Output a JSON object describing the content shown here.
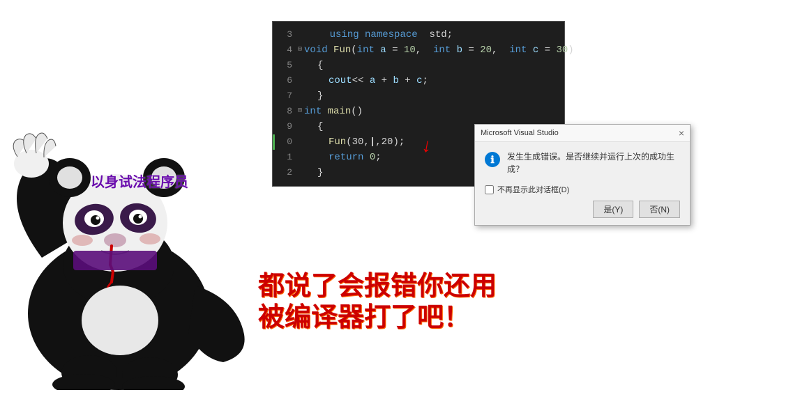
{
  "editor": {
    "lines": [
      {
        "num": "3",
        "hasCollapse": false,
        "hasIndicator": false,
        "indent": 0,
        "html": "    <span class='keyword'>using</span> <span class='keyword'>namespace</span> <span style='color:#d4d4d4'>std;</span>"
      },
      {
        "num": "4",
        "hasCollapse": true,
        "hasIndicator": false,
        "indent": 0,
        "html": "<span class='keyword'>void</span> <span class='function-name'>Fun</span>(<span class='keyword'>int</span> <span class='param-var'>a</span> <span class='operator'>=</span> <span class='number'>10</span>,  <span class='keyword'>int</span> <span class='param-var'>b</span> <span class='operator'>=</span> <span class='number'>20</span>,  <span class='keyword'>int</span> <span class='param-var'>c</span> <span class='operator'>=</span> <span class='number'>30</span>)"
      },
      {
        "num": "5",
        "hasCollapse": false,
        "hasIndicator": false,
        "indent": 1,
        "html": "{"
      },
      {
        "num": "6",
        "hasCollapse": false,
        "hasIndicator": false,
        "indent": 2,
        "html": "<span style='color:#9cdcfe'>cout</span><span class='operator'>&lt;&lt;</span> <span class='param-var'>a</span> <span class='operator'>+</span> <span class='param-var'>b</span> <span class='operator'>+</span> <span class='param-var'>c</span>;"
      },
      {
        "num": "7",
        "hasCollapse": false,
        "hasIndicator": false,
        "indent": 1,
        "html": "}"
      },
      {
        "num": "8",
        "hasCollapse": true,
        "hasIndicator": false,
        "indent": 0,
        "html": "<span class='keyword'>int</span> <span class='function-name'>main</span>()"
      },
      {
        "num": "9",
        "hasCollapse": false,
        "hasIndicator": false,
        "indent": 1,
        "html": "{"
      },
      {
        "num": "0",
        "hasCollapse": false,
        "hasIndicator": true,
        "indent": 2,
        "html": "<span class='function-name'>Fun</span>(30,<span style='color:red'>|</span>,20);"
      },
      {
        "num": "1",
        "hasCollapse": false,
        "hasIndicator": false,
        "indent": 2,
        "html": "<span class='keyword'>return</span> <span class='number'>0</span>;"
      },
      {
        "num": "2",
        "hasCollapse": false,
        "hasIndicator": false,
        "indent": 1,
        "html": "}"
      }
    ]
  },
  "dialog": {
    "title": "Microsoft Visual Studio",
    "message": "发生生成错误。是否继续并运行上次的成功生成？",
    "yes_label": "是(Y)",
    "no_label": "否(N)",
    "checkbox_label": "不再显示此对话框(D)",
    "close_label": "×"
  },
  "labels": {
    "programmer": "以身试法程序员",
    "bottom_line1": "都说了会报错你还用",
    "bottom_line2": "被编译器打了吧！"
  },
  "colors": {
    "accent_red": "#cc0000",
    "accent_purple": "#6a0dad",
    "code_bg": "#1e1e1e"
  }
}
